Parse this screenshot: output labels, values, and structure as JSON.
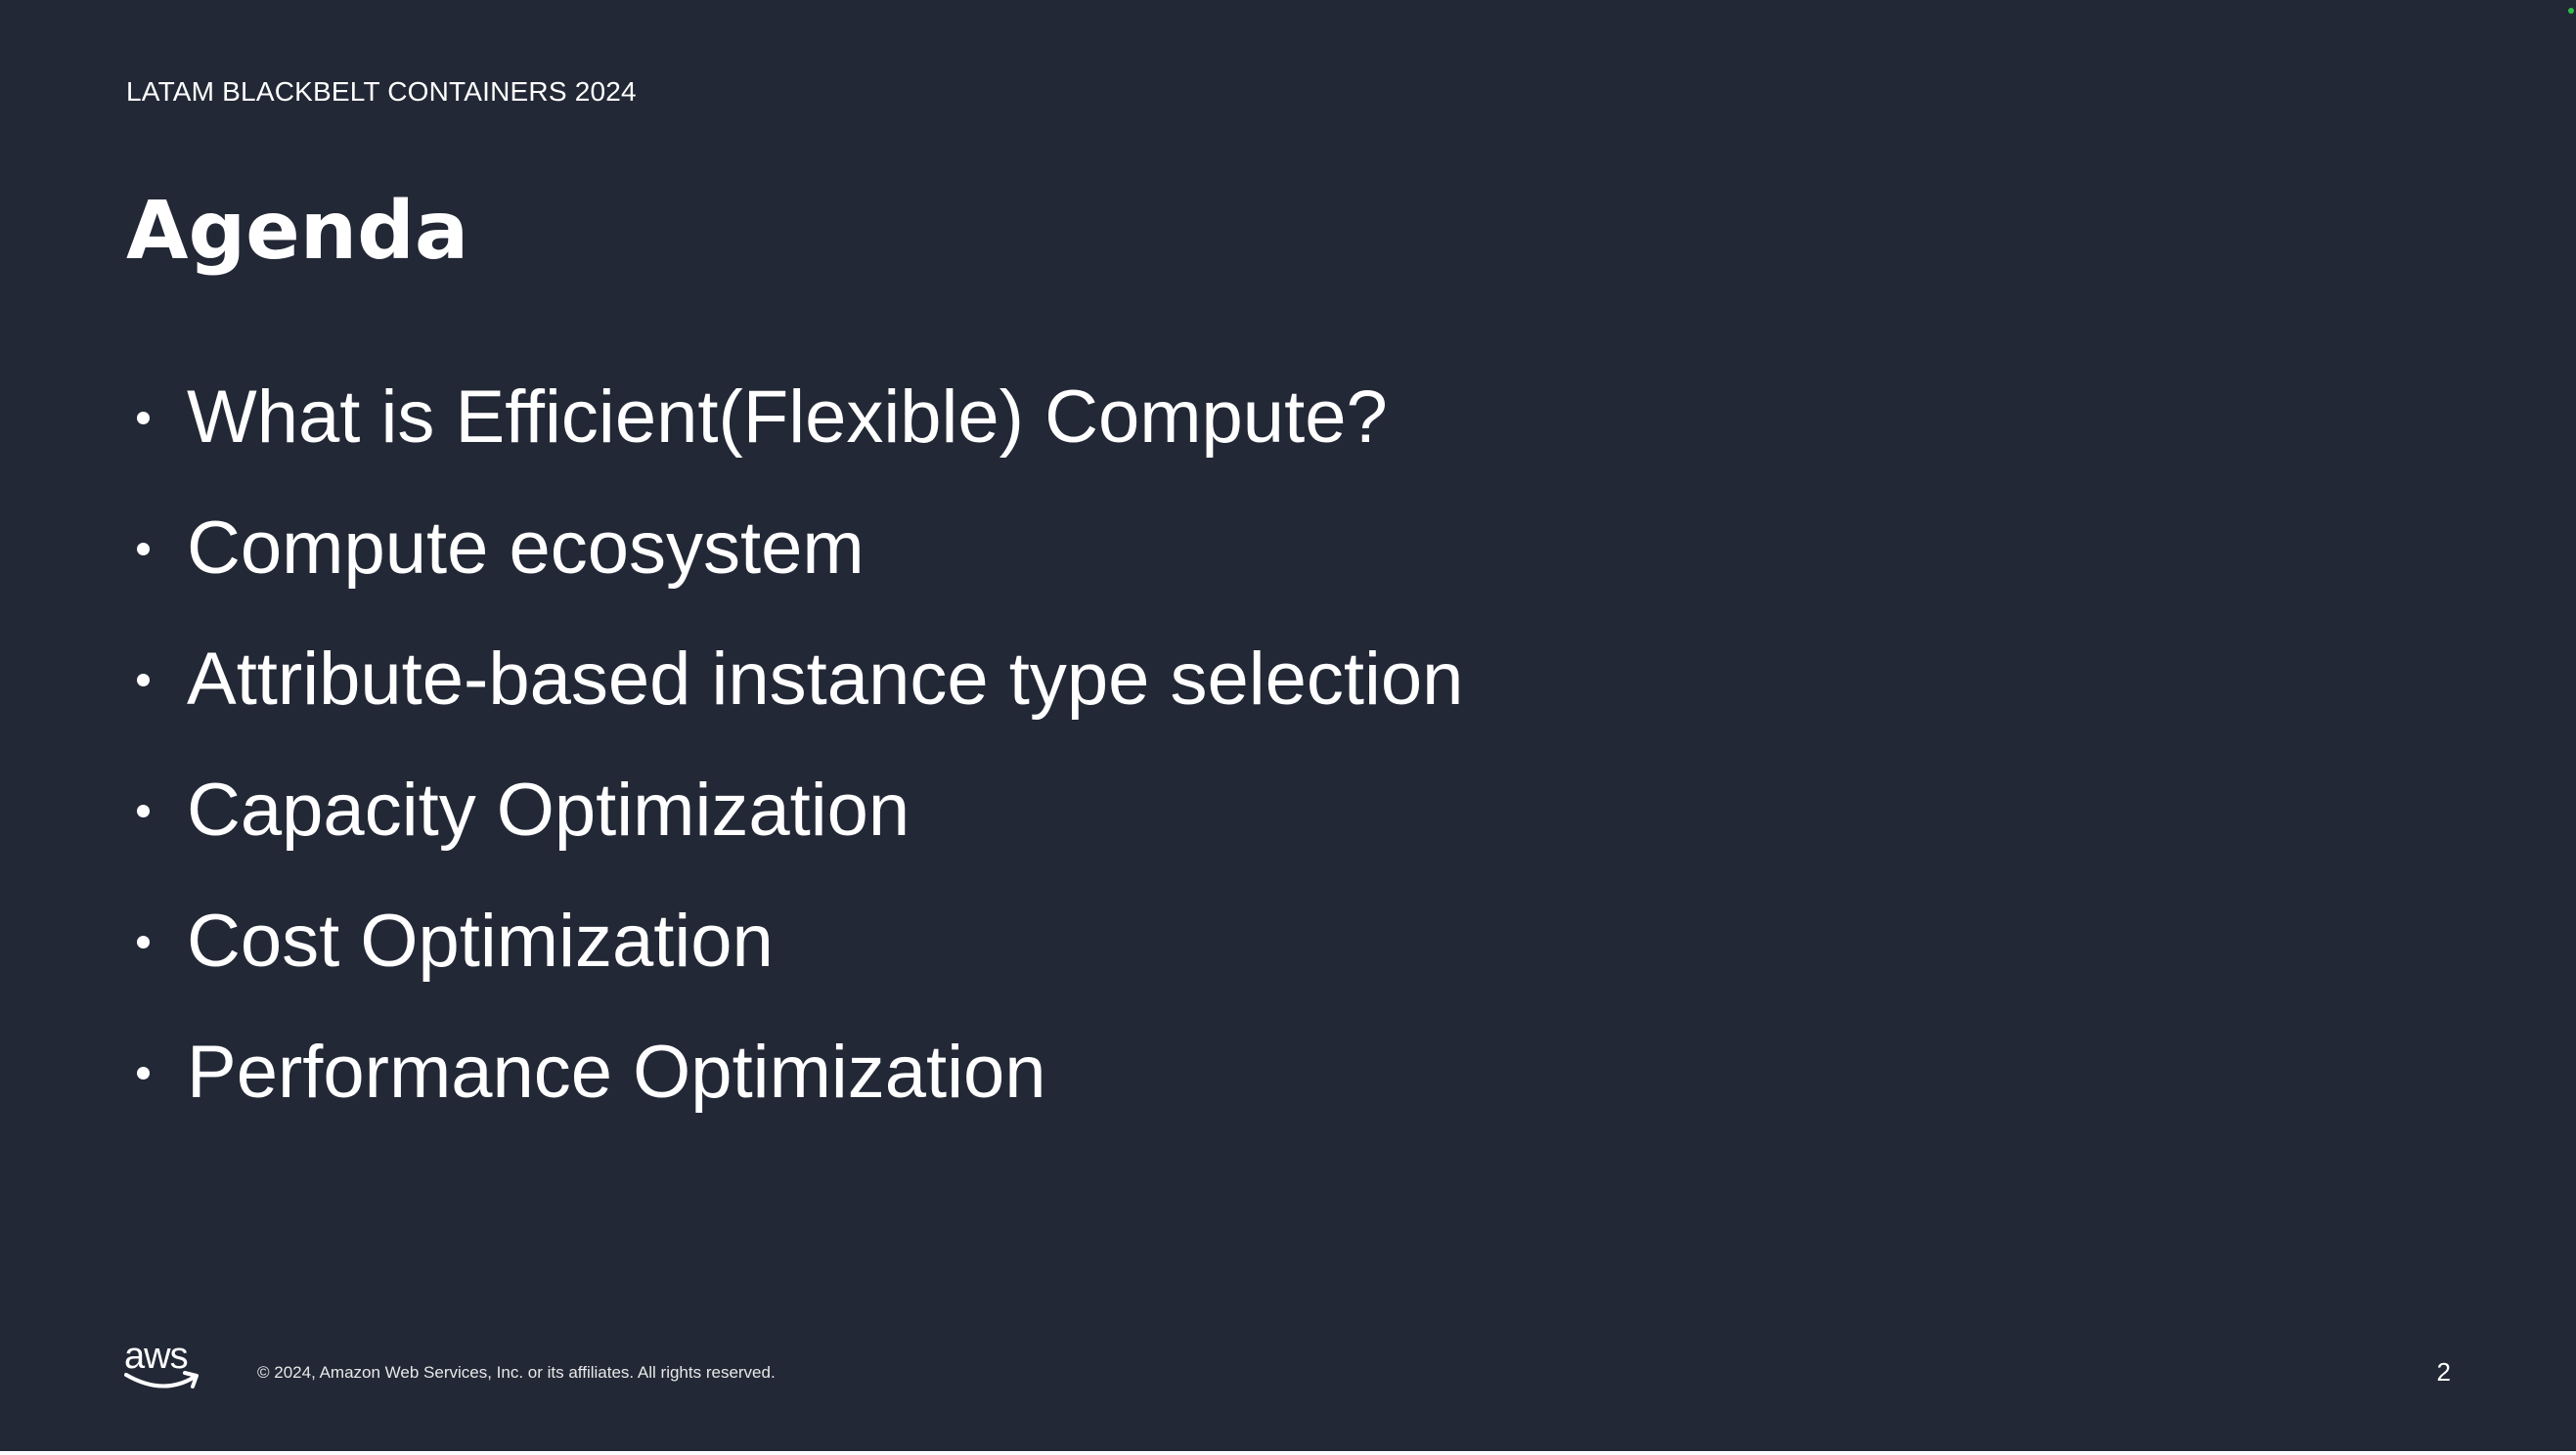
{
  "slide": {
    "eyebrow": "LATAM BLACKBELT CONTAINERS 2024",
    "title": "Agenda",
    "agenda_items": [
      {
        "label": "What is Efficient(Flexible) Compute?"
      },
      {
        "label": "Compute ecosystem"
      },
      {
        "label": "Attribute-based instance type selection"
      },
      {
        "label": "Capacity Optimization"
      },
      {
        "label": "Cost Optimization"
      },
      {
        "label": "Performance Optimization"
      }
    ],
    "footer": {
      "logo_text": "aws",
      "copyright": "© 2024, Amazon Web Services, Inc. or its affiliates. All rights reserved.",
      "page_number": "2"
    }
  },
  "colors": {
    "background": "#232836",
    "text": "#ffffff",
    "logo_smile": "#ffffff",
    "status_dot": "#2fbf4a"
  },
  "icons": {
    "bullet": "bullet-dot-icon",
    "logo": "aws-logo-icon",
    "status": "status-dot-icon"
  }
}
